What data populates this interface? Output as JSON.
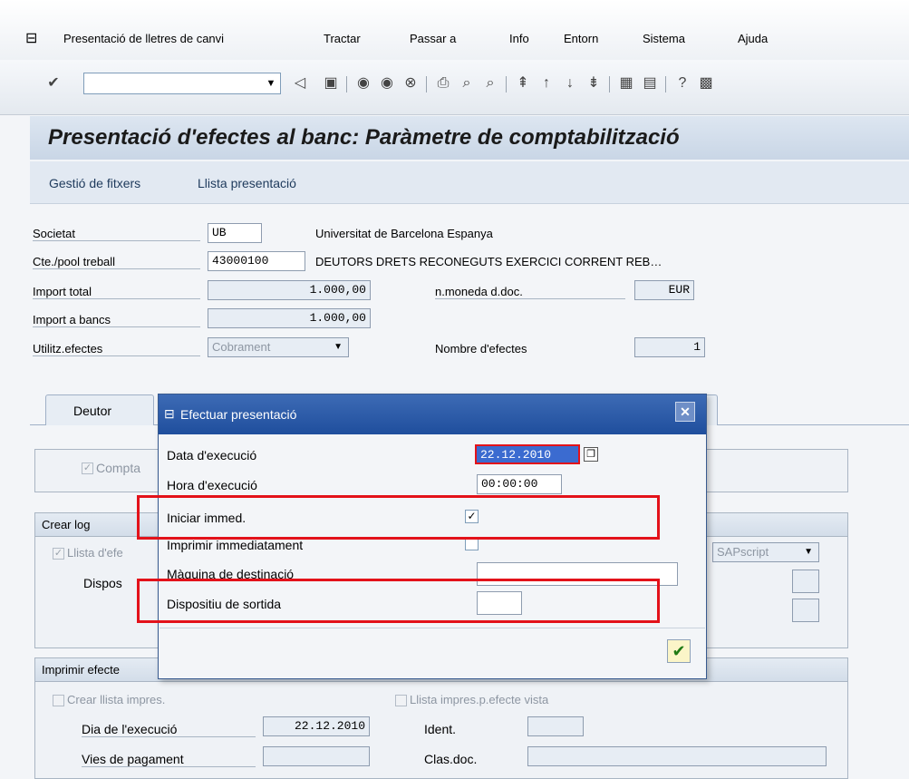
{
  "menu": {
    "items": [
      "Presentació de lletres de canvi",
      "Tractar",
      "Passar a",
      "Info",
      "Entorn",
      "Sistema",
      "Ajuda"
    ]
  },
  "title": "Presentació d'efectes al banc: Paràmetre de comptabilització",
  "app_toolbar": [
    "Gestió de fitxers",
    "Llista presentació"
  ],
  "form": {
    "societat_label": "Societat",
    "societat_value": "UB",
    "societat_text": "Universitat de Barcelona Espanya",
    "cte_label": "Cte./pool treball",
    "cte_value": "43000100",
    "cte_text": "DEUTORS DRETS RECONEGUTS EXERCICI CORRENT REB…",
    "import_total_label": "Import total",
    "import_total_value": "1.000,00",
    "moneda_label": "n.moneda d.doc.",
    "moneda_value": "EUR",
    "import_bancs_label": "Import a bancs",
    "import_bancs_value": "1.000,00",
    "utilitz_label": "Utilitz.efectes",
    "utilitz_value": "Cobrament",
    "nombre_label": "Nombre d'efectes",
    "nombre_value": "1"
  },
  "tabs": [
    "Deutor"
  ],
  "background": {
    "compta_label": "Compta",
    "crear_log": "Crear log",
    "llista_efe": "Llista d'efe",
    "dispos": "Dispos",
    "sapscript": "SAPscript",
    "imprimir_efecte": "Imprimir efecte",
    "crear_llista": "Crear llista impres.",
    "llista_impres": "Llista impres.p.efecte vista",
    "dia_label": "Dia de l'execució",
    "dia_value": "22.12.2010",
    "ident_label": "Ident.",
    "vies_label": "Vies de pagament",
    "clas_label": "Clas.doc."
  },
  "dialog": {
    "title": "Efectuar presentació",
    "data_label": "Data d'execució",
    "data_value": "22.12.2010",
    "hora_label": "Hora d'execució",
    "hora_value": "00:00:00",
    "iniciar_label": "Iniciar immed.",
    "iniciar_checked": true,
    "imprimir_label": "Imprimir immediatament",
    "maquina_label": "Màquina de destinació",
    "dispositiu_label": "Dispositiu de sortida"
  },
  "colors": {
    "highlight": "#e3121a",
    "dialog_title": "#1f4e9d"
  }
}
